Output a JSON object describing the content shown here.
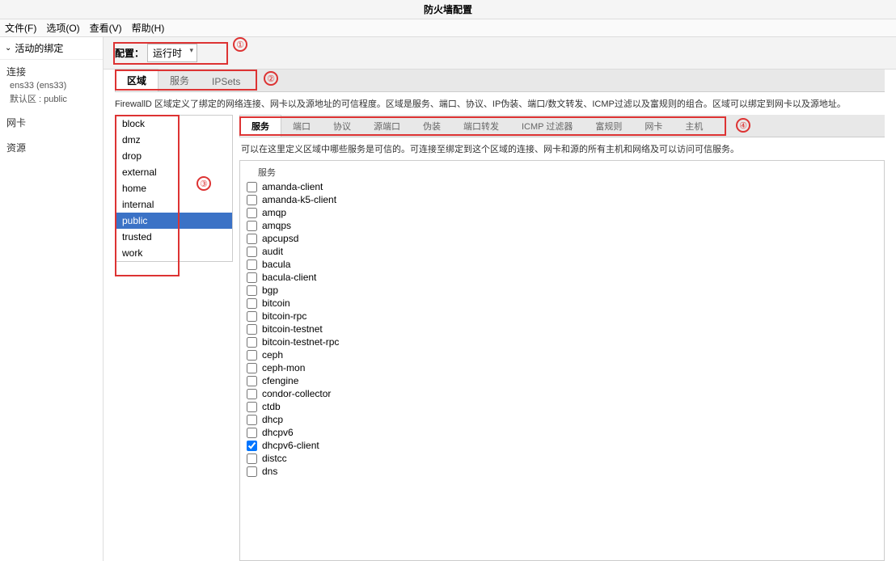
{
  "title": "防火墙配置",
  "menu": {
    "file": "文件(F)",
    "options": "选项(O)",
    "view": "查看(V)",
    "help": "帮助(H)"
  },
  "left": {
    "header": "活动的绑定",
    "sections": [
      {
        "hdr": "连接",
        "items": [
          "ens33 (ens33)",
          "默认区 : public"
        ]
      },
      {
        "hdr": "网卡",
        "items": []
      },
      {
        "hdr": "资源",
        "items": []
      }
    ]
  },
  "config": {
    "label": "配置：",
    "value": "运行时"
  },
  "tabs": {
    "t0": "区域",
    "t1": "服务",
    "t2": "IPSets"
  },
  "desc": "FirewallD 区域定义了绑定的网络连接、网卡以及源地址的可信程度。区域是服务、端口、协议、IP伪装、端口/数文转发、ICMP过滤以及富规则的组合。区域可以绑定到网卡以及源地址。",
  "zones": [
    "block",
    "dmz",
    "drop",
    "external",
    "home",
    "internal",
    "public",
    "trusted",
    "work"
  ],
  "subtabs": {
    "s0": "服务",
    "s1": "端口",
    "s2": "协议",
    "s3": "源端口",
    "s4": "伪装",
    "s5": "端口转发",
    "s6": "ICMP 过滤器",
    "s7": "富规则",
    "s8": "网卡",
    "s9": "主机"
  },
  "subdesc": "可以在这里定义区域中哪些服务是可信的。可连接至绑定到这个区域的连接、网卡和源的所有主机和网络及可以访问可信服务。",
  "svchdr": "服务",
  "services": [
    {
      "n": "amanda-client",
      "c": false
    },
    {
      "n": "amanda-k5-client",
      "c": false
    },
    {
      "n": "amqp",
      "c": false
    },
    {
      "n": "amqps",
      "c": false
    },
    {
      "n": "apcupsd",
      "c": false
    },
    {
      "n": "audit",
      "c": false
    },
    {
      "n": "bacula",
      "c": false
    },
    {
      "n": "bacula-client",
      "c": false
    },
    {
      "n": "bgp",
      "c": false
    },
    {
      "n": "bitcoin",
      "c": false
    },
    {
      "n": "bitcoin-rpc",
      "c": false
    },
    {
      "n": "bitcoin-testnet",
      "c": false
    },
    {
      "n": "bitcoin-testnet-rpc",
      "c": false
    },
    {
      "n": "ceph",
      "c": false
    },
    {
      "n": "ceph-mon",
      "c": false
    },
    {
      "n": "cfengine",
      "c": false
    },
    {
      "n": "condor-collector",
      "c": false
    },
    {
      "n": "ctdb",
      "c": false
    },
    {
      "n": "dhcp",
      "c": false
    },
    {
      "n": "dhcpv6",
      "c": false
    },
    {
      "n": "dhcpv6-client",
      "c": true
    },
    {
      "n": "distcc",
      "c": false
    },
    {
      "n": "dns",
      "c": false
    }
  ],
  "annotations": {
    "a1": "①",
    "a2": "②",
    "a3": "③",
    "a4": "④"
  }
}
